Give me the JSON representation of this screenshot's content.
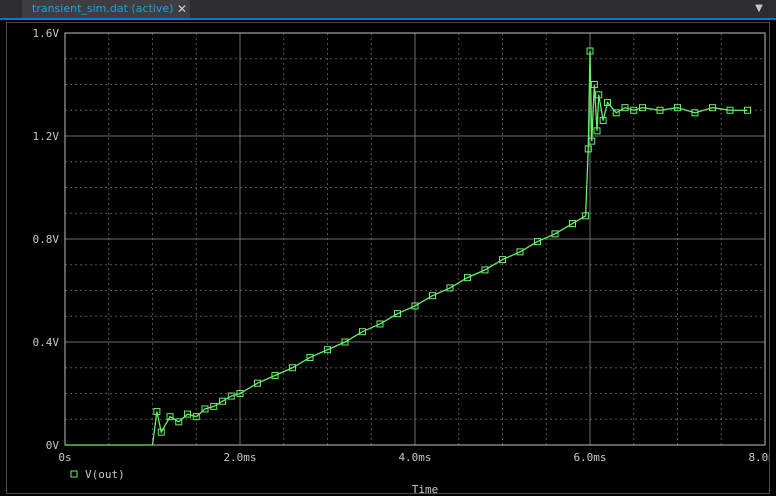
{
  "tab": {
    "title": "transient_sim.dat (active)",
    "close_glyph": "✕",
    "dropdown_glyph": "▼"
  },
  "colors": {
    "trace": "#6af06a",
    "grid": "#7a7a7a",
    "axis_text": "#c8c8c8",
    "background": "#000000"
  },
  "chart_data": {
    "type": "line",
    "xlabel": "Time",
    "ylabel": "",
    "xlim": [
      0,
      8.0
    ],
    "ylim": [
      0,
      1.6
    ],
    "x_unit": "ms",
    "y_unit": "V",
    "x_ticks": [
      "0s",
      "2.0ms",
      "4.0ms",
      "6.0ms",
      "8.0ms"
    ],
    "y_ticks": [
      "0V",
      "0.4V",
      "0.8V",
      "1.2V",
      "1.6V"
    ],
    "grid": true,
    "legend": "bottom-left",
    "series": [
      {
        "name": "V(out)",
        "marker": "square-hollow",
        "x": [
          0,
          1.0,
          1.05,
          1.1,
          1.2,
          1.3,
          1.4,
          1.5,
          1.6,
          1.7,
          1.8,
          1.9,
          2.0,
          2.2,
          2.4,
          2.6,
          2.8,
          3.0,
          3.2,
          3.4,
          3.6,
          3.8,
          4.0,
          4.2,
          4.4,
          4.6,
          4.8,
          5.0,
          5.2,
          5.4,
          5.6,
          5.8,
          5.95,
          5.98,
          6.0,
          6.02,
          6.05,
          6.08,
          6.1,
          6.15,
          6.2,
          6.3,
          6.4,
          6.5,
          6.6,
          6.8,
          7.0,
          7.2,
          7.4,
          7.6,
          7.8
        ],
        "y": [
          0,
          0,
          0.13,
          0.05,
          0.11,
          0.09,
          0.12,
          0.11,
          0.14,
          0.15,
          0.17,
          0.19,
          0.2,
          0.24,
          0.27,
          0.3,
          0.34,
          0.37,
          0.4,
          0.44,
          0.47,
          0.51,
          0.54,
          0.58,
          0.61,
          0.65,
          0.68,
          0.72,
          0.75,
          0.79,
          0.82,
          0.86,
          0.89,
          1.15,
          1.53,
          1.18,
          1.4,
          1.22,
          1.36,
          1.26,
          1.33,
          1.29,
          1.31,
          1.3,
          1.31,
          1.3,
          1.31,
          1.29,
          1.31,
          1.3,
          1.3
        ]
      }
    ]
  }
}
